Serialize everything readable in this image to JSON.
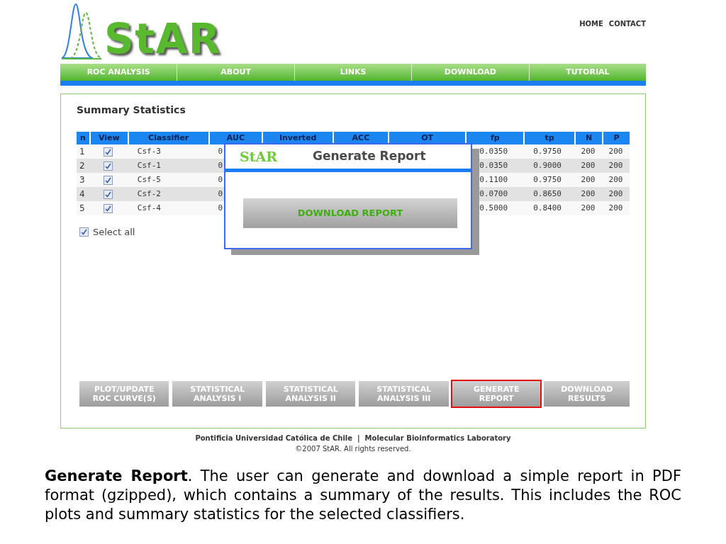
{
  "header": {
    "logo": "StAR",
    "top_links": [
      "HOME",
      "CONTACT"
    ]
  },
  "nav": [
    "ROC ANALYSIS",
    "ABOUT",
    "LINKS",
    "DOWNLOAD",
    "TUTORIAL"
  ],
  "panel": {
    "title": "Summary Statistics",
    "table": {
      "columns": [
        "n",
        "View",
        "Classifier",
        "AUC",
        "Inverted",
        "ACC",
        "OT",
        "fp",
        "tp",
        "N",
        "P"
      ],
      "rows": [
        {
          "n": "1",
          "checked": true,
          "classifier": "Csf-3",
          "auc": "0",
          "fp": "0.0350",
          "tp": "0.9750",
          "N": "200",
          "P": "200"
        },
        {
          "n": "2",
          "checked": true,
          "classifier": "Csf-1",
          "auc": "0",
          "fp": "0.0350",
          "tp": "0.9000",
          "N": "200",
          "P": "200"
        },
        {
          "n": "3",
          "checked": true,
          "classifier": "Csf-5",
          "auc": "0",
          "fp": "0.1100",
          "tp": "0.9750",
          "N": "200",
          "P": "200"
        },
        {
          "n": "4",
          "checked": true,
          "classifier": "Csf-2",
          "auc": "0",
          "fp": "0.0700",
          "tp": "0.8650",
          "N": "200",
          "P": "200"
        },
        {
          "n": "5",
          "checked": true,
          "classifier": "Csf-4",
          "auc": "0",
          "fp": "0.5000",
          "tp": "0.8400",
          "N": "200",
          "P": "200"
        }
      ]
    },
    "select_all": {
      "label": "Select all",
      "checked": true
    },
    "buttons": [
      {
        "label": "PLOT/UPDATE ROC CURVE(S)",
        "highlighted": false
      },
      {
        "label": "STATISTICAL ANALYSIS I",
        "highlighted": false
      },
      {
        "label": "STATISTICAL ANALYSIS II",
        "highlighted": false
      },
      {
        "label": "STATISTICAL ANALYSIS III",
        "highlighted": false
      },
      {
        "label": "GENERATE REPORT",
        "highlighted": true
      },
      {
        "label": "DOWNLOAD RESULTS",
        "highlighted": false
      }
    ]
  },
  "dialog": {
    "logo": "StAR",
    "title": "Generate Report",
    "button": "DOWNLOAD REPORT"
  },
  "footer": {
    "line1": "Pontificia Universidad Católica de Chile  |  Molecular Bioinformatics Laboratory",
    "line2": "©2007 StAR. All rights reserved."
  },
  "caption": "**Generate Report**. The user can generate and download a simple report in PDF format (gzipped), which contains a summary of the results. This includes the ROC plots and summary statistics for the selected classifiers."
}
